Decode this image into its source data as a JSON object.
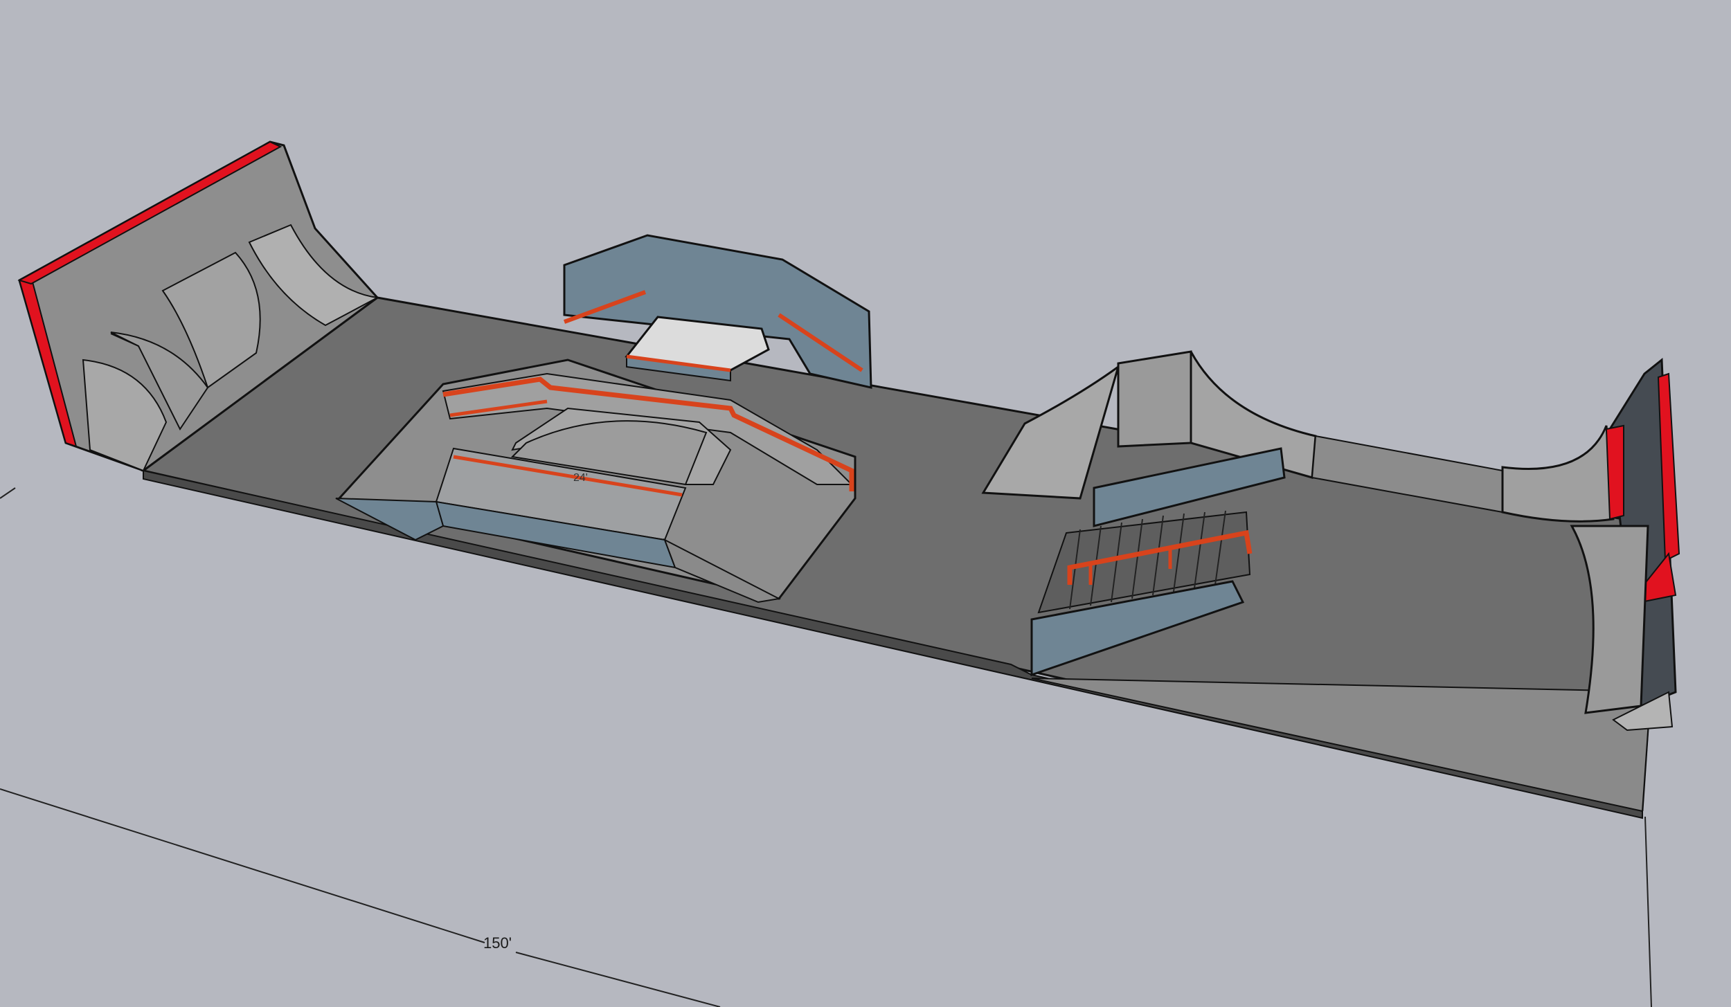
{
  "viewport": {
    "background": "#b6b8c0"
  },
  "model": {
    "palette": {
      "floor": "#6e6e6e",
      "floor_side": "#4e4e4e",
      "ramp_light": "#a8a8a8",
      "ramp_mid": "#8c8c8c",
      "ramp_dark": "#767676",
      "wall_blue": "#6f8594",
      "wall_blue_light": "#8497a4",
      "coping_red": "#e1121f",
      "rail_orange": "#d8431c",
      "deck_white": "#dcdcdc",
      "edge": "#111111"
    },
    "dimensions": {
      "overall_length": "150'",
      "inner_label": "24'"
    }
  }
}
